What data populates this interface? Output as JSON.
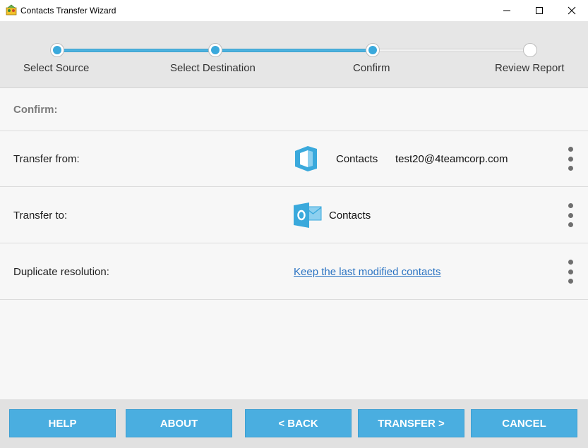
{
  "window": {
    "title": "Contacts Transfer Wizard",
    "icons": [
      "app-icon",
      "minimize-icon",
      "maximize-icon",
      "close-icon"
    ]
  },
  "steps": [
    {
      "label": "Select Source",
      "state": "done"
    },
    {
      "label": "Select Destination",
      "state": "done"
    },
    {
      "label": "Confirm",
      "state": "current"
    },
    {
      "label": "Review Report",
      "state": "pending"
    }
  ],
  "confirm": {
    "header": "Confirm:",
    "transfer_from": {
      "label": "Transfer from:",
      "icon": "office-icon",
      "folder": "Contacts",
      "account": "test20@4teamcorp.com"
    },
    "transfer_to": {
      "label": "Transfer to:",
      "icon": "outlook-icon",
      "folder": "Contacts"
    },
    "duplicate": {
      "label": "Duplicate resolution:",
      "value": "Keep the last modified contacts"
    }
  },
  "buttons": {
    "help": "HELP",
    "about": "ABOUT",
    "back": "< BACK",
    "transfer": "TRANSFER >",
    "cancel": "CANCEL"
  },
  "colors": {
    "accent": "#4aaee0",
    "link": "#2a73c2",
    "stepper_bg": "#e6e6e6",
    "footer_bg": "#e1e1e1"
  }
}
